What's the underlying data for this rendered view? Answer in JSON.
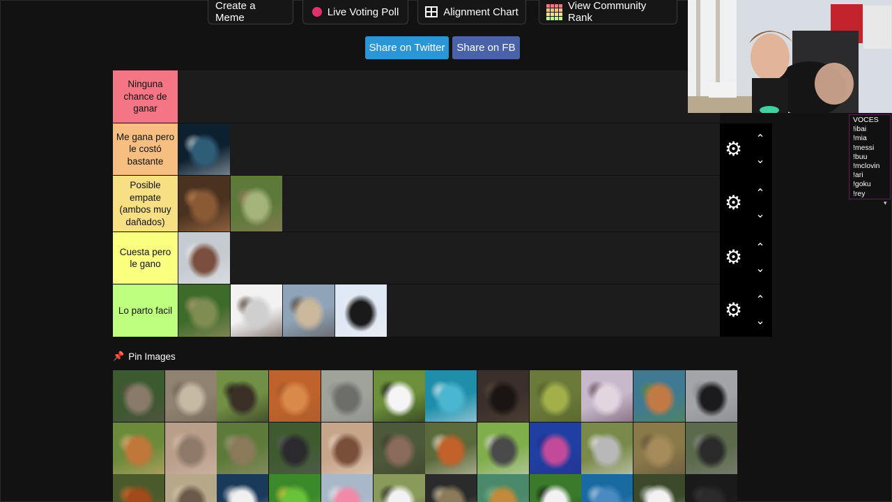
{
  "toolbar": {
    "create_meme": "Create a Meme",
    "live_voting": "Live Voting Poll",
    "alignment": "Alignment Chart",
    "community_rank": "View Community Rank"
  },
  "share": {
    "twitter": "Share on Twitter",
    "facebook": "Share on FB"
  },
  "tiers": [
    {
      "label": "Ninguna chance de ganar",
      "color": "#f47584",
      "items": []
    },
    {
      "label": "Me gana pero le costó bastante",
      "color": "#f6bf81",
      "items": [
        "whale"
      ]
    },
    {
      "label": "Posible empate (ambos muy dañados)",
      "color": "#f7df84",
      "items": [
        "bear",
        "kangaroo"
      ]
    },
    {
      "label": "Cuesta pero le gano",
      "color": "#fbff7f",
      "items": [
        "walrus"
      ]
    },
    {
      "label": "Lo parto facil",
      "color": "#beff80",
      "items": [
        "sloth",
        "scorpion",
        "ostrich",
        "penguin"
      ]
    }
  ],
  "pin_label": "Pin Images",
  "pool_rows": [
    [
      "elephant",
      "snake",
      "buffalo",
      "meerkat",
      "rhino-grey",
      "cow",
      "shark",
      "crocodile",
      "chameleon",
      "ostrich-flamingo",
      "deer",
      "crow"
    ],
    [
      "squirrel",
      "armadillo",
      "tortoise",
      "gorilla",
      "pitbull",
      "hippo",
      "fox",
      "anteater",
      "octopus",
      "koala",
      "hyena",
      "black-rhino"
    ],
    [
      "orangutan",
      "seal",
      "polar-bear",
      "parrot",
      "flamingo",
      "zebra",
      "owl",
      "giraffe",
      "panda",
      "dolphin",
      "rabbit",
      "panther"
    ]
  ],
  "chat": {
    "title": "VOCES",
    "commands": [
      "!ibai",
      "!mia",
      "!messi",
      "!buu",
      "!mclovin",
      "!ari",
      "!goku",
      "!rey"
    ]
  }
}
